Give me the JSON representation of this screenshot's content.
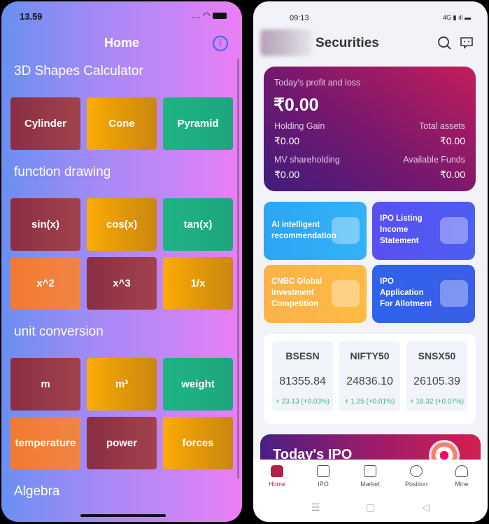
{
  "left_app": {
    "status": {
      "time": "13.59",
      "signal": "....",
      "wifi_icon": "wifi-icon",
      "battery_icon": "battery-icon"
    },
    "title": "Home",
    "info_icon": "info-icon",
    "sections": [
      {
        "title": "3D Shapes Calculator",
        "tiles": [
          {
            "label": "Cylinder",
            "color": "#8a2d44"
          },
          {
            "label": "Cone",
            "color": "#fbab03"
          },
          {
            "label": "Pyramid",
            "color": "#1db584"
          }
        ]
      },
      {
        "title": "function drawing",
        "tiles": [
          {
            "label": "sin(x)",
            "color": "#8a2d44"
          },
          {
            "label": "cos(x)",
            "color": "#fbab03"
          },
          {
            "label": "tan(x)",
            "color": "#1db584"
          },
          {
            "label": "x^2",
            "color": "#f37a2f"
          },
          {
            "label": "x^3",
            "color": "#8a2d44"
          },
          {
            "label": "1/x",
            "color": "#fbab03"
          }
        ]
      },
      {
        "title": "unit conversion",
        "tiles": [
          {
            "label": "m",
            "color": "#8a2d44"
          },
          {
            "label": "m³",
            "color": "#fbab03"
          },
          {
            "label": "weight",
            "color": "#1db584"
          },
          {
            "label": "temperature",
            "color": "#f37a2f"
          },
          {
            "label": "power",
            "color": "#8a2d44"
          },
          {
            "label": "forces",
            "color": "#fbab03"
          }
        ]
      },
      {
        "title": "Algebra",
        "tiles": []
      }
    ]
  },
  "right_app": {
    "status": {
      "time": "09:13",
      "icons": "4G ▮ ıll ▬"
    },
    "title": "Securities",
    "search_icon": "search-icon",
    "message_icon": "message-icon",
    "pl_card": {
      "title": "Today's profit and loss",
      "amount": "₹0.00",
      "holding_gain_label": "Holding Gain",
      "holding_gain": "₹0.00",
      "total_assets_label": "Total assets",
      "total_assets": "₹0.00",
      "mv_label": "MV shareholding",
      "mv": "₹0.00",
      "funds_label": "Available Funds",
      "funds": "₹0.00"
    },
    "features": [
      {
        "line1": "AI intelligent",
        "line2": "recommendation",
        "line3": ""
      },
      {
        "line1": "IPO Listing",
        "line2": "Income",
        "line3": "Statement"
      },
      {
        "line1": "CNBC Global",
        "line2": "Investment",
        "line3": "Competition"
      },
      {
        "line1": "IPO",
        "line2": "Application",
        "line3": "For Allotment"
      }
    ],
    "indices": [
      {
        "name": "BSESN",
        "price": "81355.84",
        "change": "+ 23.13  (+0.03%)"
      },
      {
        "name": "NIFTY50",
        "price": "24836.10",
        "change": "+ 1.25  (+0.01%)"
      },
      {
        "name": "SNSX50",
        "price": "26105.39",
        "change": "+ 18.32  (+0.07%)"
      }
    ],
    "banner_title": "Today's IPO",
    "nav": [
      {
        "label": "Home",
        "icon": "home-icon"
      },
      {
        "label": "IPO",
        "icon": "ipo-icon"
      },
      {
        "label": "Market",
        "icon": "chart-icon"
      },
      {
        "label": "Position",
        "icon": "pie-chart-icon"
      },
      {
        "label": "Mine",
        "icon": "user-icon"
      }
    ],
    "system_nav": {
      "menu": "☰",
      "home": "▢",
      "back": "◁"
    }
  }
}
